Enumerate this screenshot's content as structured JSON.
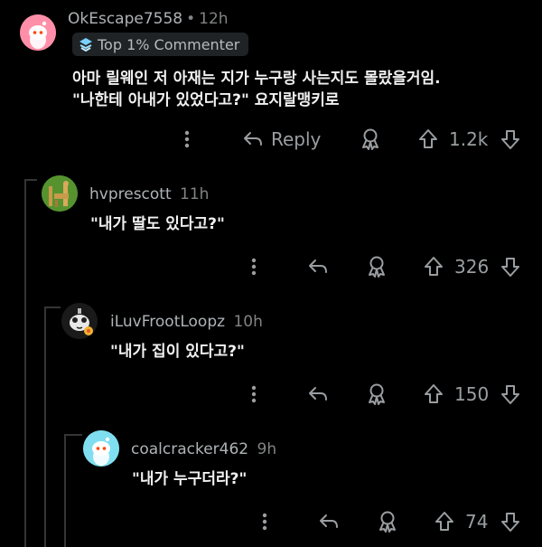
{
  "comments": [
    {
      "username": "OkEscape7558",
      "time": "12h",
      "flair": "Top 1% Commenter",
      "body_lines": [
        "아마 릴웨인 저 아재는 지가 누구랑 사는지도 몰랐을거임.",
        "\"나한테 아내가 있었다고?\" 요지랄맹키로"
      ],
      "reply_label": "Reply",
      "votes": "1.2k",
      "avatar_color": "#ff8fa9"
    },
    {
      "username": "hvprescott",
      "time": "11h",
      "body_lines": [
        "\"내가 딸도 있다고?\""
      ],
      "votes": "326",
      "avatar_color": "#4f8b2d"
    },
    {
      "username": "iLuvFrootLoopz",
      "time": "10h",
      "body_lines": [
        "\"내가 집이 있다고?\""
      ],
      "votes": "150",
      "avatar_color": "#e8e8e8"
    },
    {
      "username": "coalcracker462",
      "time": "9h",
      "body_lines": [
        "\"내가 누구더라?\""
      ],
      "votes": "74",
      "avatar_color": "#7fdff0"
    }
  ]
}
